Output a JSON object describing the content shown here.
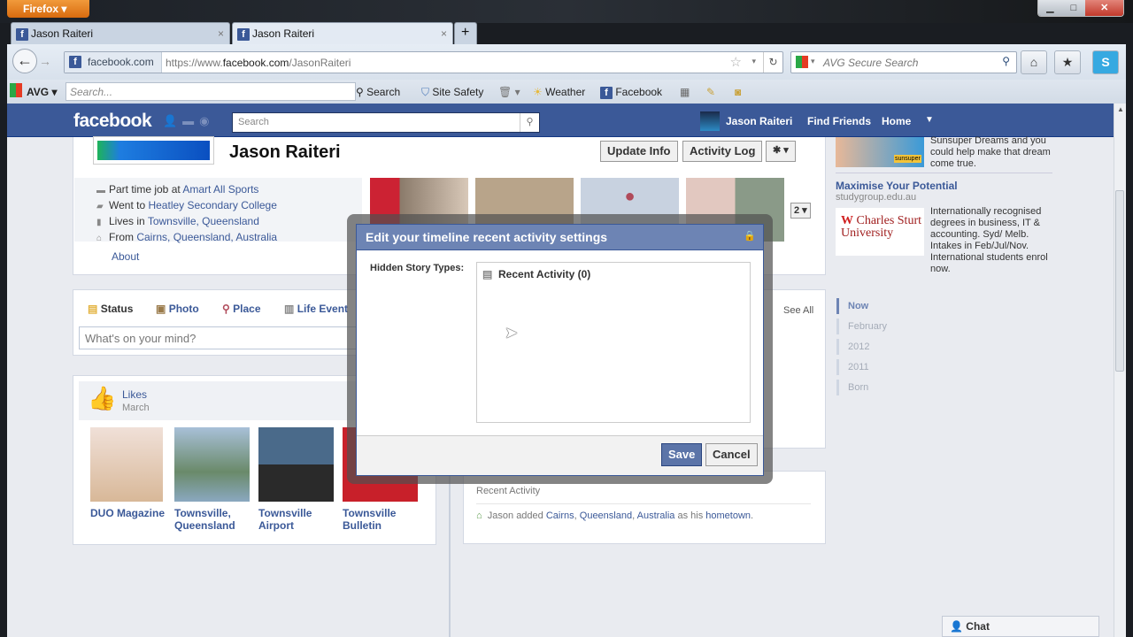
{
  "browser": {
    "menu_button": "Firefox",
    "tabs": [
      {
        "title": "Jason Raiteri"
      },
      {
        "title": "Jason Raiteri"
      }
    ],
    "new_tab": "+",
    "identity": "facebook.com",
    "url_prefix": "https://www.",
    "url_domain": "facebook.com",
    "url_path": "/JasonRaiteri",
    "search_placeholder": "AVG Secure Search"
  },
  "avg_toolbar": {
    "brand": "AVG",
    "search_placeholder": "Search...",
    "search_label": "Search",
    "site_safety": "Site Safety",
    "weather": "Weather",
    "facebook": "Facebook"
  },
  "fb_header": {
    "logo": "facebook",
    "search_placeholder": "Search",
    "user": "Jason Raiteri",
    "find_friends": "Find Friends",
    "home": "Home"
  },
  "profile": {
    "name": "Jason Raiteri",
    "update_info": "Update Info",
    "activity_log": "Activity Log",
    "photo_count": "2",
    "info": [
      {
        "prefix": "Part time job at ",
        "link": "Amart All Sports"
      },
      {
        "prefix": "Went to ",
        "link": "Heatley Secondary College"
      },
      {
        "prefix": "Lives in ",
        "link": "Townsville, Queensland"
      },
      {
        "prefix": "From ",
        "link": "Cairns, Queensland, Australia"
      }
    ],
    "about": "About"
  },
  "composer": {
    "status": "Status",
    "photo": "Photo",
    "place": "Place",
    "life_event": "Life Event",
    "placeholder": "What's on your mind?",
    "see_all": "See All"
  },
  "likes": {
    "title": "Likes",
    "subtitle": "March",
    "items": [
      "DUO Magazine",
      "Townsville, Queensland",
      "Townsville Airport",
      "Townsville Bulletin"
    ]
  },
  "recent": {
    "title": "Recent Activity",
    "story": {
      "prefix": "Jason added ",
      "links": [
        "Cairns",
        "Queensland",
        "Australia"
      ],
      "middle": " as his ",
      "tail": "hometown",
      "end": "."
    }
  },
  "ads": [
    {
      "text": "Sunsuper Dreams and you could help make that dream come true.",
      "badge": "sunsuper"
    },
    {
      "title": "Maximise Your Potential",
      "domain": "studygroup.edu.au",
      "logo": "Charles Sturt University",
      "text": "Internationally recognised degrees in business, IT & accounting. Syd/ Melb. Intakes in Feb/Jul/Nov. International students enrol now."
    }
  ],
  "timeline": [
    "Now",
    "February",
    "2012",
    "2011",
    "Born"
  ],
  "dialog": {
    "title": "Edit your timeline recent activity settings",
    "label": "Hidden Story Types:",
    "item": "Recent Activity (0)",
    "save": "Save",
    "cancel": "Cancel"
  },
  "chat": "Chat"
}
